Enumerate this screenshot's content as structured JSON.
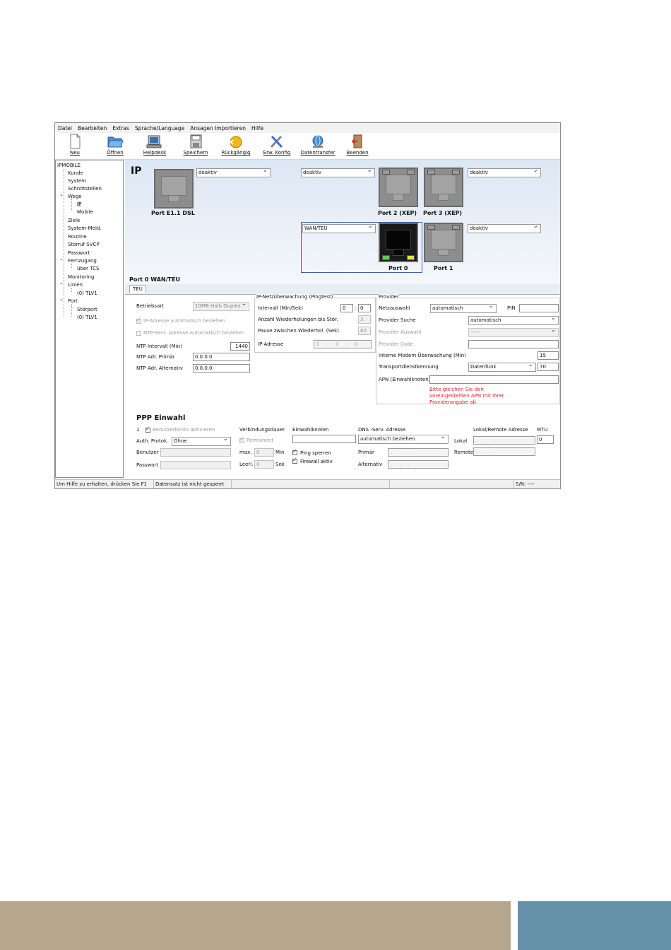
{
  "menu": [
    "Datei",
    "Bearbeiten",
    "Extras",
    "Sprache/Language",
    "Ansagen Importieren",
    "Hilfe"
  ],
  "toolbar": [
    {
      "label": "Neu",
      "icon": "new-document-icon"
    },
    {
      "label": "Öffnen",
      "icon": "open-folder-icon"
    },
    {
      "label": "Helpdesk",
      "icon": "helpdesk-icon"
    },
    {
      "label": "Speichern",
      "icon": "save-icon"
    },
    {
      "label": "Rückgängig",
      "icon": "undo-icon"
    },
    {
      "label": "Erw. Konfig",
      "icon": "tools-icon"
    },
    {
      "label": "Datentransfer",
      "icon": "globe-transfer-icon"
    },
    {
      "label": "Beenden",
      "icon": "exit-door-icon"
    }
  ],
  "tree": [
    "IPMOBILE",
    "Kunde",
    "System",
    "Schnittstellen",
    "Wege",
    "IP",
    "Mobile",
    "Ziele",
    "System-Meld.",
    "Routine",
    "Störruf SVCP",
    "Passwort",
    "Fernzugang",
    "über TCS",
    "Monitoring",
    "Linien",
    "(0) TLV1",
    "Port",
    "Störport",
    "(0) TLV1"
  ],
  "ports": {
    "title": "IP",
    "e11_select": "deaktiv",
    "e11_label": "Port E1.1 DSL",
    "p2_select": "deaktiv",
    "p2_label": "Port 2 (XEP)",
    "p3_select": "deaktiv",
    "p3_label": "Port 3 (XEP)",
    "p0_select": "WAN/TEU",
    "p0_label": "Port 0",
    "p1_select": "deaktiv",
    "p1_label": "Port 1",
    "colors": {
      "active_border": "#3a5fb0",
      "led_green": "#59d14a",
      "led_yellow": "#e6e24a"
    }
  },
  "section_title": "Port 0 WAN/TEU",
  "tab_label": "TEU",
  "left": {
    "betriebsart_label": "Betriebsart",
    "betriebsart_value": "10MB Halb Duplex",
    "ip_auto": "IP-Adresse automatisch beziehen",
    "ntp_auto": "NTP-Serv. Adresse automatisch beziehen",
    "ntp_interval_label": "NTP Intervall (Min)",
    "ntp_interval_value": "1440",
    "ntp_primary_label": "NTP Adr. Primär",
    "ntp_primary_value": "0.0.0.0",
    "ntp_alt_label": "NTP Adr. Alternativ",
    "ntp_alt_value": "0.0.0.0"
  },
  "ping": {
    "title": "IP-Netzüberwachung (Pingtest)",
    "interval_label": "Intervall (Min/Sek)",
    "interval_min": "0",
    "interval_sep": ":",
    "interval_sec": "0",
    "repeat_label": "Anzahl Wiederholungen bis Stör.",
    "repeat_value": "3",
    "pause_label": "Pause zwischen Wiederhol. (Sek)",
    "pause_value": "60",
    "ip_label": "IP-Adresse",
    "ip_value": "0 . 0 . 0 . 0"
  },
  "provider": {
    "title": "Provider",
    "netz_label": "Netzauswahl",
    "netz_value": "automatisch",
    "pin_label": "PIN",
    "suche_label": "Provider Suche",
    "suche_value": "automatisch",
    "auswahl_label": "Provider Auswahl",
    "auswahl_value": "-----",
    "code_label": "Provider Code",
    "modem_label": "Interne Modem Überwachung (Min)",
    "modem_value": "15",
    "transport_label": "Transportdienstkennung",
    "transport_select": "Datenfunk",
    "transport_value": "70",
    "apn_label": "APN (Einwahlknoten)",
    "hint": "Bitte gleichen Sie den voreingestellten APN mit Ihrer Providerangabe ab"
  },
  "ppp": {
    "title": "PPP Einwahl",
    "index": "1",
    "account_label": "Benutzerkonto aktivieren",
    "auth_label": "Auth. Protok.",
    "auth_value": "Ohne",
    "user_label": "Benutzer",
    "pass_label": "Passwort",
    "dauer_label": "Verbindungsdauer",
    "permanent_label": "Permanent",
    "max_label": "max.",
    "max_value": "0",
    "max_unit": "Min",
    "leer_label": "Leerl.",
    "leer_value": "0",
    "leer_unit": "Sek",
    "einwahl_label": "Einwahlknoten",
    "ping_sperren": "Ping sperren",
    "firewall": "Firewall aktiv",
    "dns_label": "DNS -Serv. Adresse",
    "dns_value": "automatisch beziehen",
    "primaer_label": "Primär",
    "alternativ_label": "Alternativ",
    "lr_label": "Lokal/Remote Adresse",
    "lokal_label": "Lokal",
    "remote_label": "Remote",
    "mtu_label": "MTU",
    "mtu_value": "0",
    "ip_placeholder": ". . ."
  },
  "status": {
    "help": "Um Hilfe zu erhalten, drücken Sie F1",
    "lock": "Datensatz ist nicht gesperrt",
    "sn": "S/N: ----"
  }
}
